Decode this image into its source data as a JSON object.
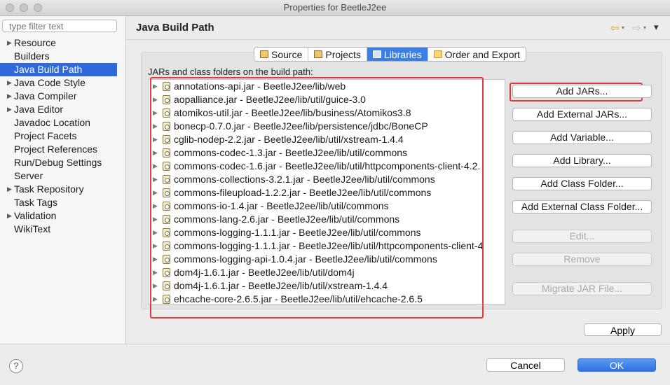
{
  "window": {
    "title": "Properties for BeetleJ2ee"
  },
  "sidebar": {
    "filter_placeholder": "type filter text",
    "items": [
      {
        "label": "Resource",
        "expandable": true
      },
      {
        "label": "Builders",
        "expandable": false
      },
      {
        "label": "Java Build Path",
        "expandable": false,
        "selected": true
      },
      {
        "label": "Java Code Style",
        "expandable": true
      },
      {
        "label": "Java Compiler",
        "expandable": true
      },
      {
        "label": "Java Editor",
        "expandable": true
      },
      {
        "label": "Javadoc Location",
        "expandable": false
      },
      {
        "label": "Project Facets",
        "expandable": false
      },
      {
        "label": "Project References",
        "expandable": false
      },
      {
        "label": "Run/Debug Settings",
        "expandable": false
      },
      {
        "label": "Server",
        "expandable": false
      },
      {
        "label": "Task Repository",
        "expandable": true
      },
      {
        "label": "Task Tags",
        "expandable": false
      },
      {
        "label": "Validation",
        "expandable": true
      },
      {
        "label": "WikiText",
        "expandable": false
      }
    ]
  },
  "header": {
    "title": "Java Build Path",
    "nav_back_glyph": "⇦",
    "nav_forward_glyph": "⇨",
    "menu_glyph": "▾"
  },
  "tabs": [
    {
      "label": "Source",
      "icon": "source-folder-icon",
      "active": false
    },
    {
      "label": "Projects",
      "icon": "projects-folder-icon",
      "active": false
    },
    {
      "label": "Libraries",
      "icon": "libraries-icon",
      "active": true
    },
    {
      "label": "Order and Export",
      "icon": "order-export-icon",
      "active": false
    }
  ],
  "libraries": {
    "section_label": "JARs and class folders on the build path:",
    "entries": [
      "annotations-api.jar - BeetleJ2ee/lib/web",
      "aopalliance.jar - BeetleJ2ee/lib/util/guice-3.0",
      "atomikos-util.jar - BeetleJ2ee/lib/business/Atomikos3.8",
      "bonecp-0.7.0.jar - BeetleJ2ee/lib/persistence/jdbc/BoneCP",
      "cglib-nodep-2.2.jar - BeetleJ2ee/lib/util/xstream-1.4.4",
      "commons-codec-1.3.jar - BeetleJ2ee/lib/util/commons",
      "commons-codec-1.6.jar - BeetleJ2ee/lib/util/httpcomponents-client-4.2.",
      "commons-collections-3.2.1.jar - BeetleJ2ee/lib/util/commons",
      "commons-fileupload-1.2.2.jar - BeetleJ2ee/lib/util/commons",
      "commons-io-1.4.jar - BeetleJ2ee/lib/util/commons",
      "commons-lang-2.6.jar - BeetleJ2ee/lib/util/commons",
      "commons-logging-1.1.1.jar - BeetleJ2ee/lib/util/commons",
      "commons-logging-1.1.1.jar - BeetleJ2ee/lib/util/httpcomponents-client-4",
      "commons-logging-api-1.0.4.jar - BeetleJ2ee/lib/util/commons",
      "dom4j-1.6.1.jar - BeetleJ2ee/lib/util/dom4j",
      "dom4j-1.6.1.jar - BeetleJ2ee/lib/util/xstream-1.4.4",
      "ehcache-core-2.6.5.jar - BeetleJ2ee/lib/util/ehcache-2.6.5"
    ]
  },
  "buttons": {
    "add_jars": "Add JARs...",
    "add_external_jars": "Add External JARs...",
    "add_variable": "Add Variable...",
    "add_library": "Add Library...",
    "add_class_folder": "Add Class Folder...",
    "add_external_class_folder": "Add External Class Folder...",
    "edit": "Edit...",
    "remove": "Remove",
    "migrate_jar": "Migrate JAR File...",
    "apply": "Apply",
    "cancel": "Cancel",
    "ok": "OK",
    "help_glyph": "?"
  },
  "colors": {
    "selection": "#2f6ad8",
    "active_tab": "#3a7ee6",
    "highlight_annotation": "#e03a3a",
    "ok_button": "#2f6fe0"
  }
}
